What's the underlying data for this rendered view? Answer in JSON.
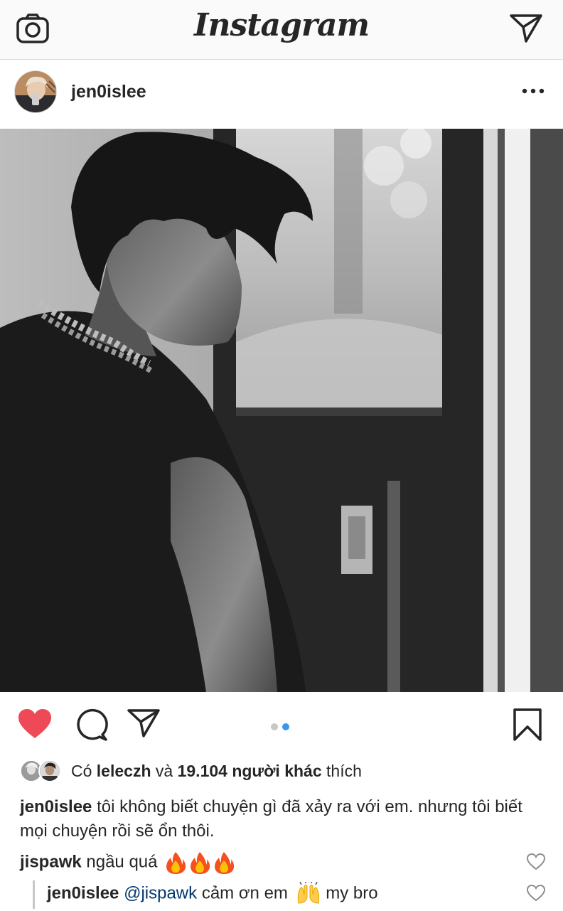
{
  "app": {
    "title": "Instagram"
  },
  "post": {
    "username": "jen0islee",
    "carousel": {
      "total": 2,
      "active": 2
    },
    "likes": {
      "prefix": "Có",
      "first_liker": "leleczh",
      "connector": "và",
      "others": "19.104 người khác",
      "suffix": "thích"
    },
    "caption": {
      "username": "jen0islee",
      "text": "tôi không biết chuyện gì đã xảy ra với em. nhưng tôi biết mọi chuyện rồi sẽ ổn thôi."
    },
    "comments": [
      {
        "username": "jispawk",
        "text": "ngầu quá",
        "emoji": "fire-emoji x3"
      },
      {
        "username": "jen0islee",
        "mention": "@jispawk",
        "text": "cảm ơn em",
        "emoji": "raising-hands-emoji",
        "tail": "my bro"
      }
    ]
  },
  "colors": {
    "like_red": "#ed4956",
    "carousel_active": "#3897f0",
    "carousel_inactive": "#c7c7c7",
    "mention": "#00376b",
    "text": "#262626"
  }
}
